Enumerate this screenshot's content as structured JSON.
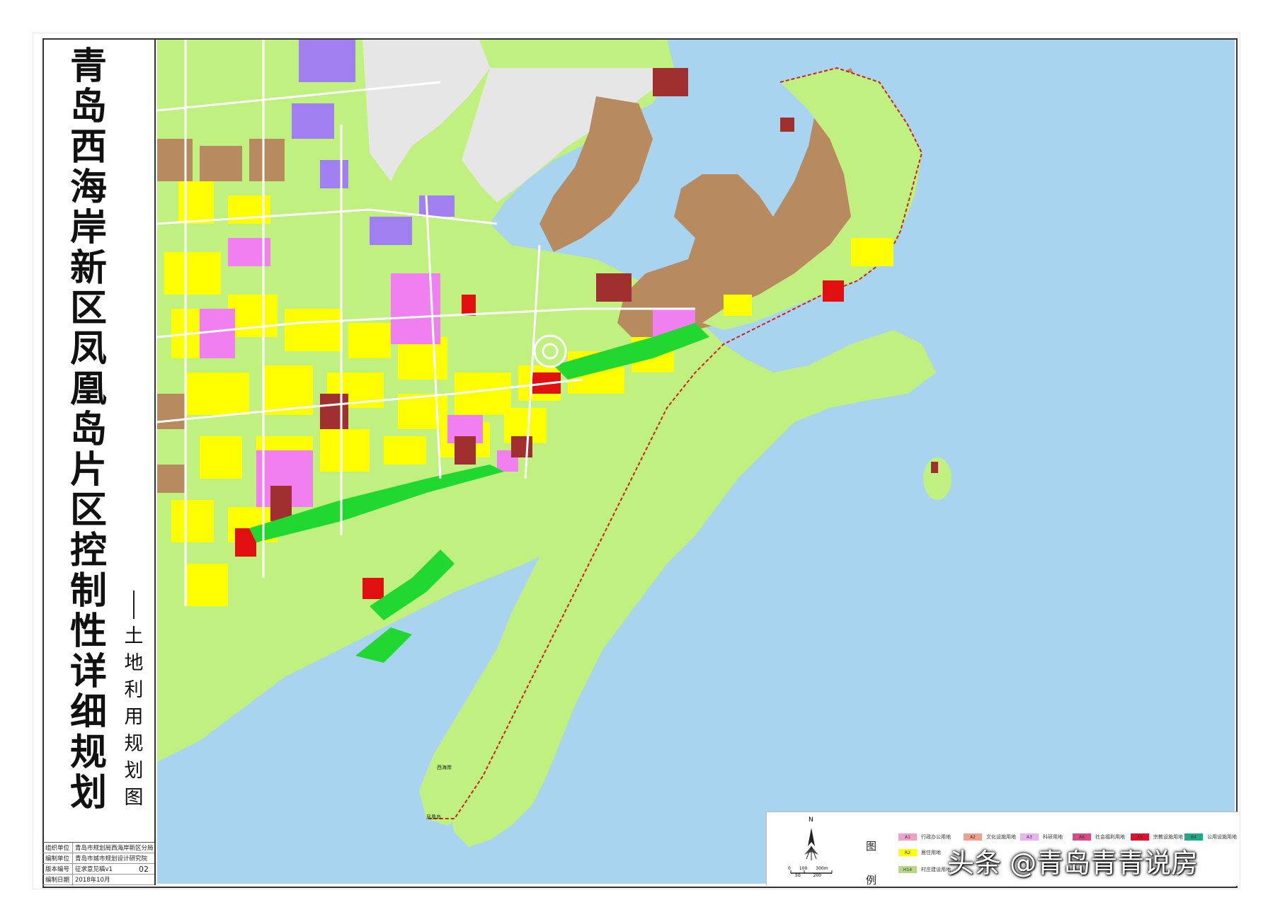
{
  "title": "青岛西海岸新区凤凰岛片区控制性详细规划",
  "subtitle": "土地利用规划图",
  "info_block": [
    {
      "key": "组织单位",
      "value": "青岛市规划局西海岸新区分局"
    },
    {
      "key": "编制单位",
      "value": "青岛市城市规划设计研究院"
    },
    {
      "key": "版本编号",
      "value": "征求意见稿v1"
    },
    {
      "key": "编制日期",
      "value": "2018年10月"
    }
  ],
  "sheet_number": "02",
  "legend": {
    "heading": "图例",
    "compass_label": "N",
    "scale_top": [
      "0",
      "100",
      "300m"
    ],
    "scale_bottom": [
      "50",
      "200"
    ],
    "items": [
      {
        "code": "A1",
        "label": "行政办公用地",
        "color": "#f2a0c8"
      },
      {
        "code": "A2",
        "label": "文化设施用地",
        "color": "#f0a08c"
      },
      {
        "code": "A3",
        "label": "科研用地",
        "color": "#e8b4f0"
      },
      {
        "code": "A6",
        "label": "社会福利用地",
        "color": "#d84a88"
      },
      {
        "code": "A9",
        "label": "宗教设施用地",
        "color": "#e01030"
      },
      {
        "code": "B4",
        "label": "公用设施用地",
        "color": "#20a888"
      },
      {
        "code": "R2",
        "label": "居住用地",
        "color": "#ffff00"
      },
      {
        "code": "H14",
        "label": "村庄建设用地",
        "color": "#b8d888"
      }
    ]
  },
  "map_labels": [
    "西海岸",
    "凤凰岛"
  ],
  "watermark": "头条 @青岛青青说房",
  "colors": {
    "sea": "#a8d4f0",
    "green_space": "#c0f080",
    "park": "#20d830",
    "residential": "#ffff00",
    "commercial": "#e01010",
    "port": "#b88a60",
    "industrial": "#a080f0",
    "admin": "#f080f0",
    "storage": "#e8e8e8",
    "mixed": "#a03030",
    "boundary": "#d02020"
  }
}
